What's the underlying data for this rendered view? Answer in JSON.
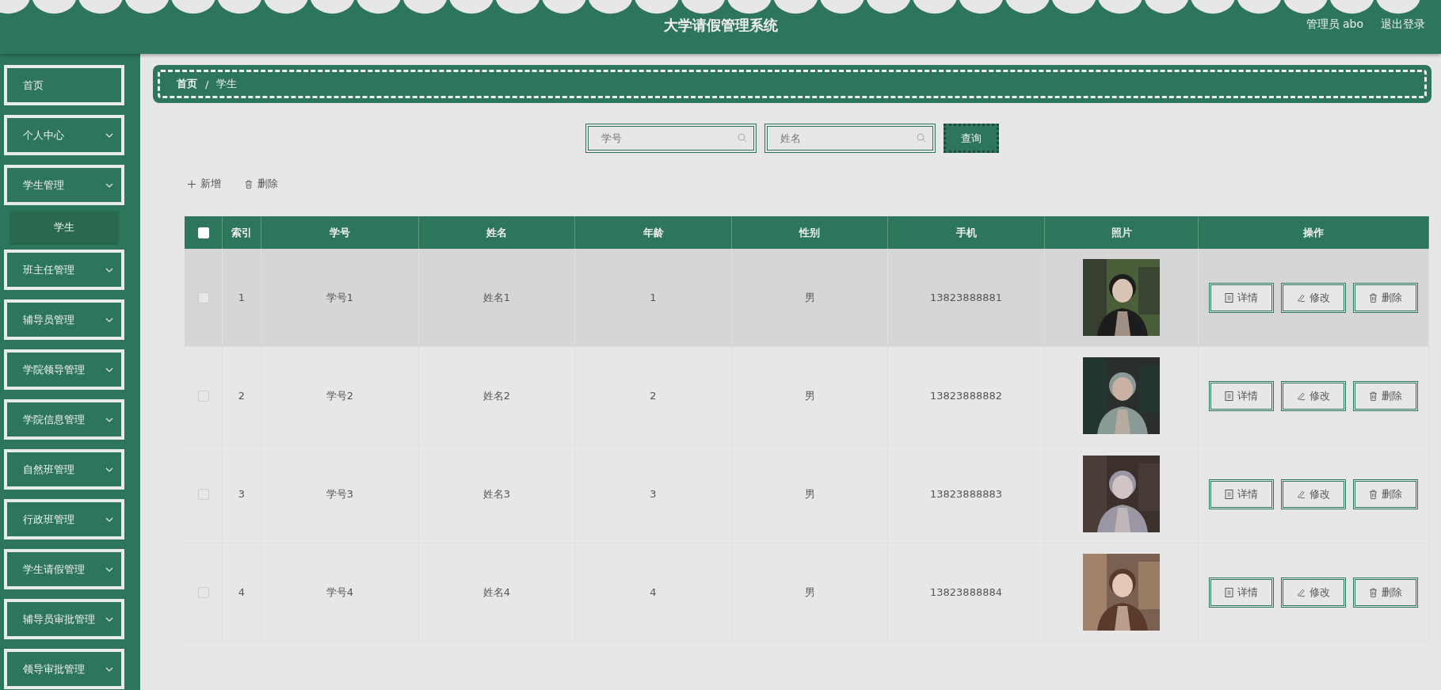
{
  "header": {
    "title": "大学请假管理系统",
    "user": "管理员 abo",
    "logout": "退出登录"
  },
  "sidebar": {
    "items": [
      {
        "label": "首页",
        "expandable": false
      },
      {
        "label": "个人中心",
        "expandable": true
      },
      {
        "label": "学生管理",
        "expandable": true,
        "children": [
          {
            "label": "学生",
            "selected": true
          }
        ]
      },
      {
        "label": "班主任管理",
        "expandable": true
      },
      {
        "label": "辅导员管理",
        "expandable": true
      },
      {
        "label": "学院领导管理",
        "expandable": true
      },
      {
        "label": "学院信息管理",
        "expandable": true
      },
      {
        "label": "自然班管理",
        "expandable": true
      },
      {
        "label": "行政班管理",
        "expandable": true
      },
      {
        "label": "学生请假管理",
        "expandable": true
      },
      {
        "label": "辅导员审批管理",
        "expandable": true
      },
      {
        "label": "领导审批管理",
        "expandable": true
      }
    ]
  },
  "breadcrumb": {
    "items": [
      "首页",
      "学生"
    ],
    "separator": "/"
  },
  "search": {
    "fields": [
      {
        "placeholder": "学号"
      },
      {
        "placeholder": "姓名"
      }
    ],
    "button": "查询"
  },
  "toolbar": {
    "add": "新增",
    "delete": "删除"
  },
  "table": {
    "columns": [
      "索引",
      "学号",
      "姓名",
      "年龄",
      "性别",
      "手机",
      "照片",
      "操作"
    ],
    "header_checked": false,
    "rows": [
      {
        "index": "1",
        "student_no": "学号1",
        "name": "姓名1",
        "age": "1",
        "gender": "男",
        "phone": "13823888881",
        "photo": {
          "kind": "picture"
        },
        "checked": false,
        "highlighted": true,
        "actions": [
          "详情",
          "修改",
          "删除"
        ]
      },
      {
        "index": "2",
        "student_no": "学号2",
        "name": "姓名2",
        "age": "2",
        "gender": "男",
        "phone": "13823888882",
        "photo": {
          "kind": "picture"
        },
        "checked": false,
        "highlighted": false,
        "actions": [
          "详情",
          "修改",
          "删除"
        ]
      },
      {
        "index": "3",
        "student_no": "学号3",
        "name": "姓名3",
        "age": "3",
        "gender": "男",
        "phone": "13823888883",
        "photo": {
          "kind": "picture"
        },
        "checked": false,
        "highlighted": false,
        "actions": [
          "详情",
          "修改",
          "删除"
        ]
      },
      {
        "index": "4",
        "student_no": "学号4",
        "name": "姓名4",
        "age": "4",
        "gender": "男",
        "phone": "13823888884",
        "photo": {
          "kind": "picture"
        },
        "checked": false,
        "highlighted": false,
        "actions": [
          "详情",
          "修改",
          "删除"
        ]
      }
    ]
  }
}
